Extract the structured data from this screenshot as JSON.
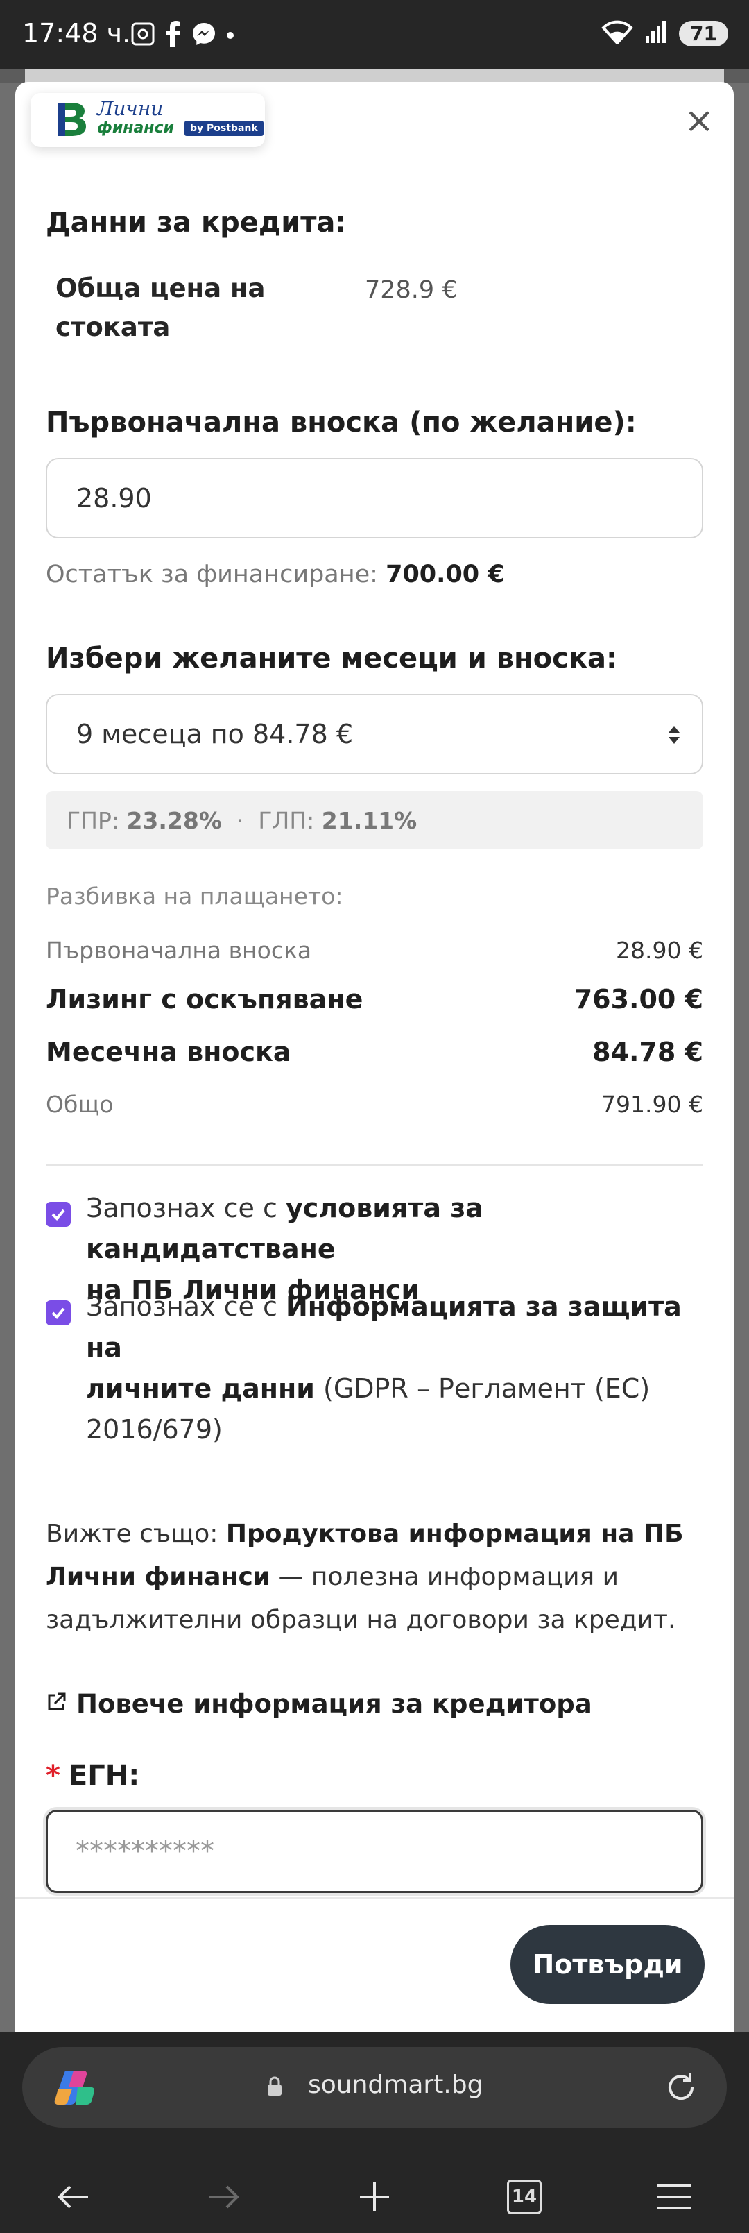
{
  "status_bar": {
    "time": "17:48 ч.",
    "battery": "71",
    "icons": [
      "screenshot-icon",
      "facebook-icon",
      "messenger-icon",
      "dot-icon",
      "wifi-icon",
      "signal-icon",
      "battery-icon"
    ]
  },
  "modal": {
    "logo": {
      "line1": "Лични",
      "line2": "финанси",
      "badge": "by Postbank",
      "letter": "В"
    },
    "close": "×",
    "credit_title": "Данни за кредита:",
    "total_price_label_1": "Обща цена на",
    "total_price_label_2": "стоката",
    "total_price_value": "728.9 €",
    "down_payment_title": "Първоначална вноска (по желание):",
    "down_payment_value": "28.90",
    "remaining_label": "Остатък за финансиране:",
    "remaining_value": "700.00 €",
    "months_title": "Избери желаните месеци и вноска:",
    "months_selected": "9 месеца по 84.78 €",
    "gpr_label": "ГПР:",
    "gpr_value": "23.28%",
    "separator": "·",
    "glp_label": "ГЛП:",
    "glp_value": "21.11%",
    "breakdown_title": "Разбивка на плащането:",
    "breakdown": {
      "down_label": "Първоначална вноска",
      "down_value": "28.90 €",
      "leasing_label": "Лизинг с оскъпяване",
      "leasing_value": "763.00 €",
      "monthly_label": "Месечна вноска",
      "monthly_value": "84.78 €",
      "total_label": "Общо",
      "total_value": "791.90 €"
    },
    "check1": {
      "prefix": "Запознах се с",
      "bold1": "условията за кандидатстване",
      "bold2": "на ПБ Лични финанси"
    },
    "check2": {
      "prefix": "Запознах се с",
      "bold1": "Информацията за защита на",
      "bold2": "личните данни",
      "suffix1": "(GDPR – Регламент (ЕС)",
      "suffix2": "2016/679)"
    },
    "see_also": {
      "prefix": "Вижте също:",
      "bold1": "Продуктова информация на ПБ",
      "bold2": "Лични финанси",
      "rest1": "— полезна информация и",
      "rest2": "задължителни образци на договори за кредит."
    },
    "more_info": "Повече информация за кредитора",
    "egn_required": "*",
    "egn_label": "ЕГН:",
    "egn_placeholder": "**********",
    "confirm": "Потвърди"
  },
  "browser": {
    "url": "soundmart.bg",
    "tabs_count": "14"
  },
  "colors": {
    "accent_check": "#7a4de6",
    "button_dark": "#2e3740",
    "required_red": "#e0202a",
    "brand_green": "#1a7f3c",
    "brand_blue": "#1c3f8c"
  }
}
